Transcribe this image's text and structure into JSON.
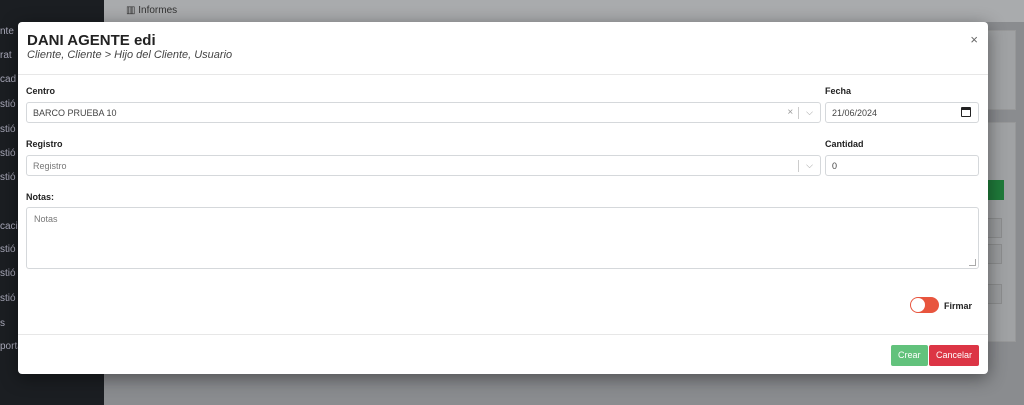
{
  "background": {
    "breadcrumb": "Informes",
    "sidebar_items": [
      "nte",
      "rat",
      "cad",
      "stió",
      "stió",
      "stió",
      "stió",
      "cació",
      "stió",
      "stió",
      "stió",
      "s",
      "porta"
    ]
  },
  "modal": {
    "title": "DANI AGENTE edi",
    "subtitle": "Cliente, Cliente > Hijo del Cliente, Usuario",
    "close_icon": "×",
    "centro": {
      "label": "Centro",
      "value": "BARCO PRUEBA 10"
    },
    "fecha": {
      "label": "Fecha",
      "value": "21/06/2024"
    },
    "registro": {
      "label": "Registro",
      "placeholder": "Registro"
    },
    "cantidad": {
      "label": "Cantidad",
      "value": "0"
    },
    "notas": {
      "label": "Notas:",
      "placeholder": "Notas"
    },
    "firmar": {
      "label": "Firmar",
      "enabled": false,
      "color": "#e8553e"
    },
    "buttons": {
      "crear": "Crear",
      "cancelar": "Cancelar"
    }
  },
  "colors": {
    "crear_button": "#62c27c",
    "cancel_button": "#dc3545"
  }
}
